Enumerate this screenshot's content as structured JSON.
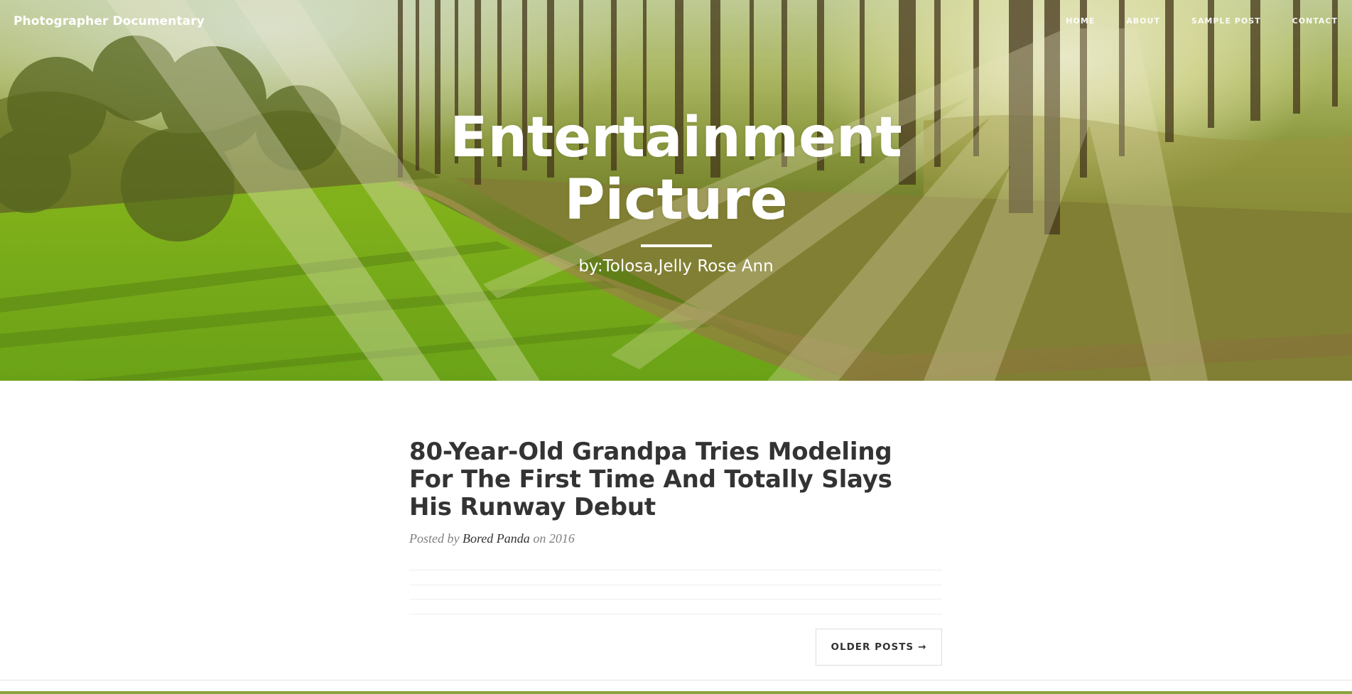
{
  "navbar": {
    "brand": "Photographer Documentary",
    "links": [
      "Home",
      "About",
      "Sample Post",
      "Contact"
    ]
  },
  "hero": {
    "title": "Entertainment Picture",
    "subtitle": "by:Tolosa,Jelly Rose Ann"
  },
  "post": {
    "title": "80-Year-Old Grandpa Tries Modeling For The First Time And Totally Slays His Runway Debut",
    "meta_prefix": "Posted by",
    "author": "Bored Panda",
    "meta_on": "on",
    "date": "2016"
  },
  "pager": {
    "older_label": "OLDER POSTS",
    "arrow": "→"
  }
}
